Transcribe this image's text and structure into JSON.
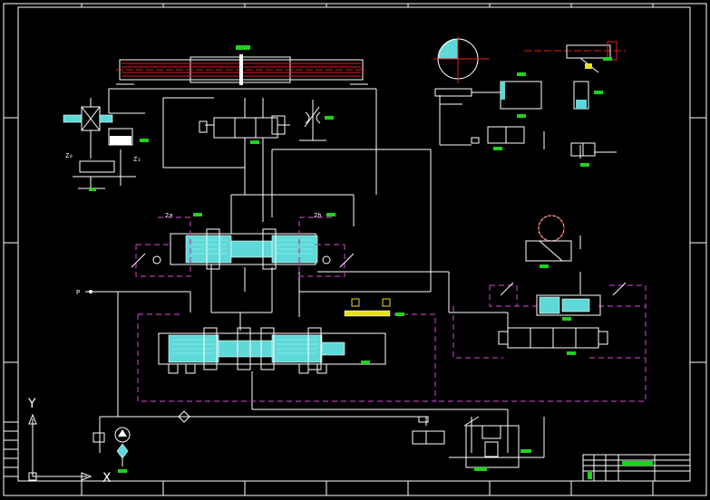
{
  "axis": {
    "y_label": "Y",
    "x_label": "X"
  },
  "labels": {
    "gear_left": "Z₀",
    "gear_right": "Z₁",
    "cyl_label_left": "2a",
    "cyl_label_right": "2b",
    "port_label": "P"
  },
  "colors": {
    "background": "#000000",
    "line": "#ffffff",
    "dashed_pilot": "#b03cb0",
    "cylinder": "#5fd8d8",
    "tag": "#1ed21e",
    "center_line": "#e02020",
    "yellow_part": "#e8e020"
  },
  "icons": [
    "pump-icon",
    "filter-icon",
    "motor-icon",
    "valve-icon",
    "throttle-icon",
    "check-valve-icon"
  ]
}
